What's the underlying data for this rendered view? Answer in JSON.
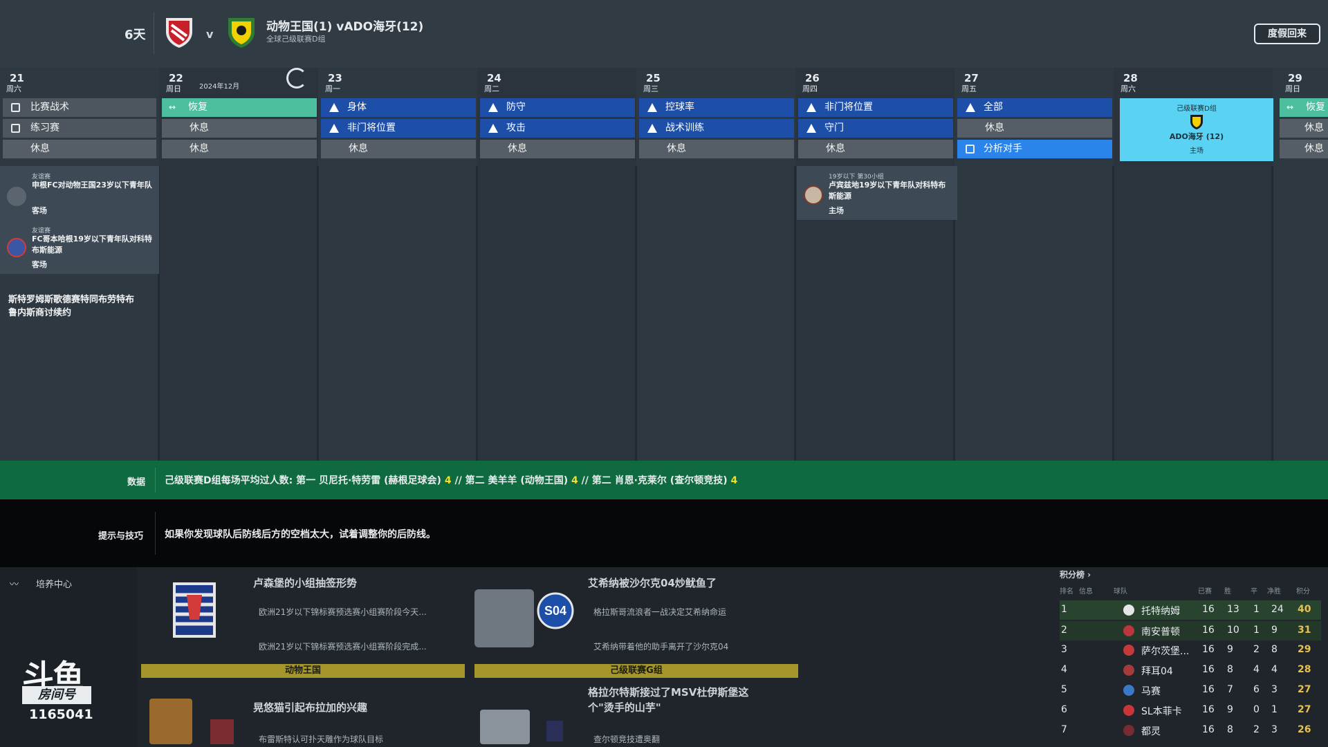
{
  "header": {
    "days": "6天",
    "vs": "v",
    "match_title": "动物王国(1) vADO海牙(12)",
    "match_sub": "全球己级联赛D组",
    "back_label": "度假回来"
  },
  "calendar": {
    "month": "2024年12月",
    "days": [
      {
        "num": "21",
        "wk": "周六"
      },
      {
        "num": "22",
        "wk": "周日"
      },
      {
        "num": "23",
        "wk": "周一"
      },
      {
        "num": "24",
        "wk": "周二"
      },
      {
        "num": "25",
        "wk": "周三"
      },
      {
        "num": "26",
        "wk": "周四"
      },
      {
        "num": "27",
        "wk": "周五"
      },
      {
        "num": "28",
        "wk": "周六"
      },
      {
        "num": "29",
        "wk": "周日"
      }
    ],
    "slots": {
      "d21": [
        "比赛战术",
        "练习赛",
        "休息"
      ],
      "d22": [
        "恢复",
        "休息",
        "休息"
      ],
      "d23": [
        "身体",
        "非门将位置",
        "休息"
      ],
      "d24": [
        "防守",
        "攻击",
        "休息"
      ],
      "d25": [
        "控球率",
        "战术训练",
        "休息"
      ],
      "d26": [
        "非门将位置",
        "守门",
        "休息"
      ],
      "d27": [
        "全部",
        "休息",
        "分析对手"
      ],
      "d29": [
        "恢复",
        "休息",
        "休息"
      ]
    },
    "match28": {
      "comp": "己级联赛D组",
      "team": "ADO海牙 (12)",
      "venue": "主场"
    },
    "events21": [
      {
        "label": "友谊赛",
        "text": "申根FC对动物王国23岁以下青年队",
        "loc": "客场"
      },
      {
        "label": "友谊赛",
        "text": "FC哥本哈根19岁以下青年队对科特布斯能源",
        "loc": "客场"
      }
    ],
    "event26": {
      "label": "19岁以下 第30小组",
      "text": "卢宾兹地19岁以下青年队对科特布斯能源",
      "loc": "主场"
    },
    "note21": "斯特罗姆斯歌德赛特同布劳特布鲁内斯商讨续约"
  },
  "databar": {
    "label": "数据",
    "t1": "己级联赛D组每场平均过人数: 第一 贝尼托·特劳雷 (赫根足球会) ",
    "v1": "4",
    "t2": " // 第二 美羊羊 (动物王国) ",
    "v2": "4",
    "t3": " // 第二 肖恩·克莱尔 (查尔顿竞技) ",
    "v3": "4"
  },
  "tips": {
    "label": "提示与技巧",
    "text": "如果你发现球队后防线后方的空档太大，试着调整你的后防线。"
  },
  "bottom": {
    "training_center": "培养中心",
    "brand": "斗鱼",
    "room_label": "房间号",
    "room_no": "1165041",
    "news": [
      {
        "head": "卢森堡的小组抽签形势",
        "b1": "欧洲21岁以下锦标赛预选赛小组赛阶段今天...",
        "b2": "欧洲21岁以下锦标赛预选赛小组赛阶段完成..."
      },
      {
        "head": "艾希纳被沙尔克04炒鱿鱼了",
        "b1": "格拉斯哥流浪者一战决定艾希纳命运",
        "b2": "艾希纳带着他的助手离开了沙尔克04"
      },
      {
        "head": "晃悠猫引起布拉加的兴趣",
        "b1": "布雷斯特认可扑天雕作为球队目标"
      },
      {
        "head": "格拉尔特斯接过了MSV杜伊斯堡这个\"烫手的山芋\"",
        "b1": "查尔顿竞技遭奥翻"
      }
    ],
    "tag1": "动物王国",
    "tag2": "己级联赛G组"
  },
  "standings": {
    "title": "积分榜 ›",
    "headers": [
      "排名",
      "信息",
      "球队",
      "已赛",
      "胜",
      "平",
      "净胜",
      "积分"
    ],
    "rows": [
      {
        "pos": "1",
        "team": "托特纳姆",
        "p": "16",
        "w": "13",
        "d": "1",
        "gd": "24",
        "pts": "40"
      },
      {
        "pos": "2",
        "team": "南安普顿",
        "p": "16",
        "w": "10",
        "d": "1",
        "gd": "9",
        "pts": "31"
      },
      {
        "pos": "3",
        "team": "萨尔茨堡...",
        "p": "16",
        "w": "9",
        "d": "2",
        "gd": "8",
        "pts": "29"
      },
      {
        "pos": "4",
        "team": "拜耳04",
        "p": "16",
        "w": "8",
        "d": "4",
        "gd": "4",
        "pts": "28"
      },
      {
        "pos": "5",
        "team": "马赛",
        "p": "16",
        "w": "7",
        "d": "6",
        "gd": "3",
        "pts": "27"
      },
      {
        "pos": "6",
        "team": "SL本菲卡",
        "p": "16",
        "w": "9",
        "d": "0",
        "gd": "1",
        "pts": "27"
      },
      {
        "pos": "7",
        "team": "都灵",
        "p": "16",
        "w": "8",
        "d": "2",
        "gd": "3",
        "pts": "26"
      }
    ]
  },
  "colors": {
    "blue_slot": "#1d4fa8",
    "teal_slot": "#4dbf9f",
    "match_card": "#59d2f3",
    "data_bar": "#0f6a3f",
    "highlight": "#f0de2c"
  }
}
